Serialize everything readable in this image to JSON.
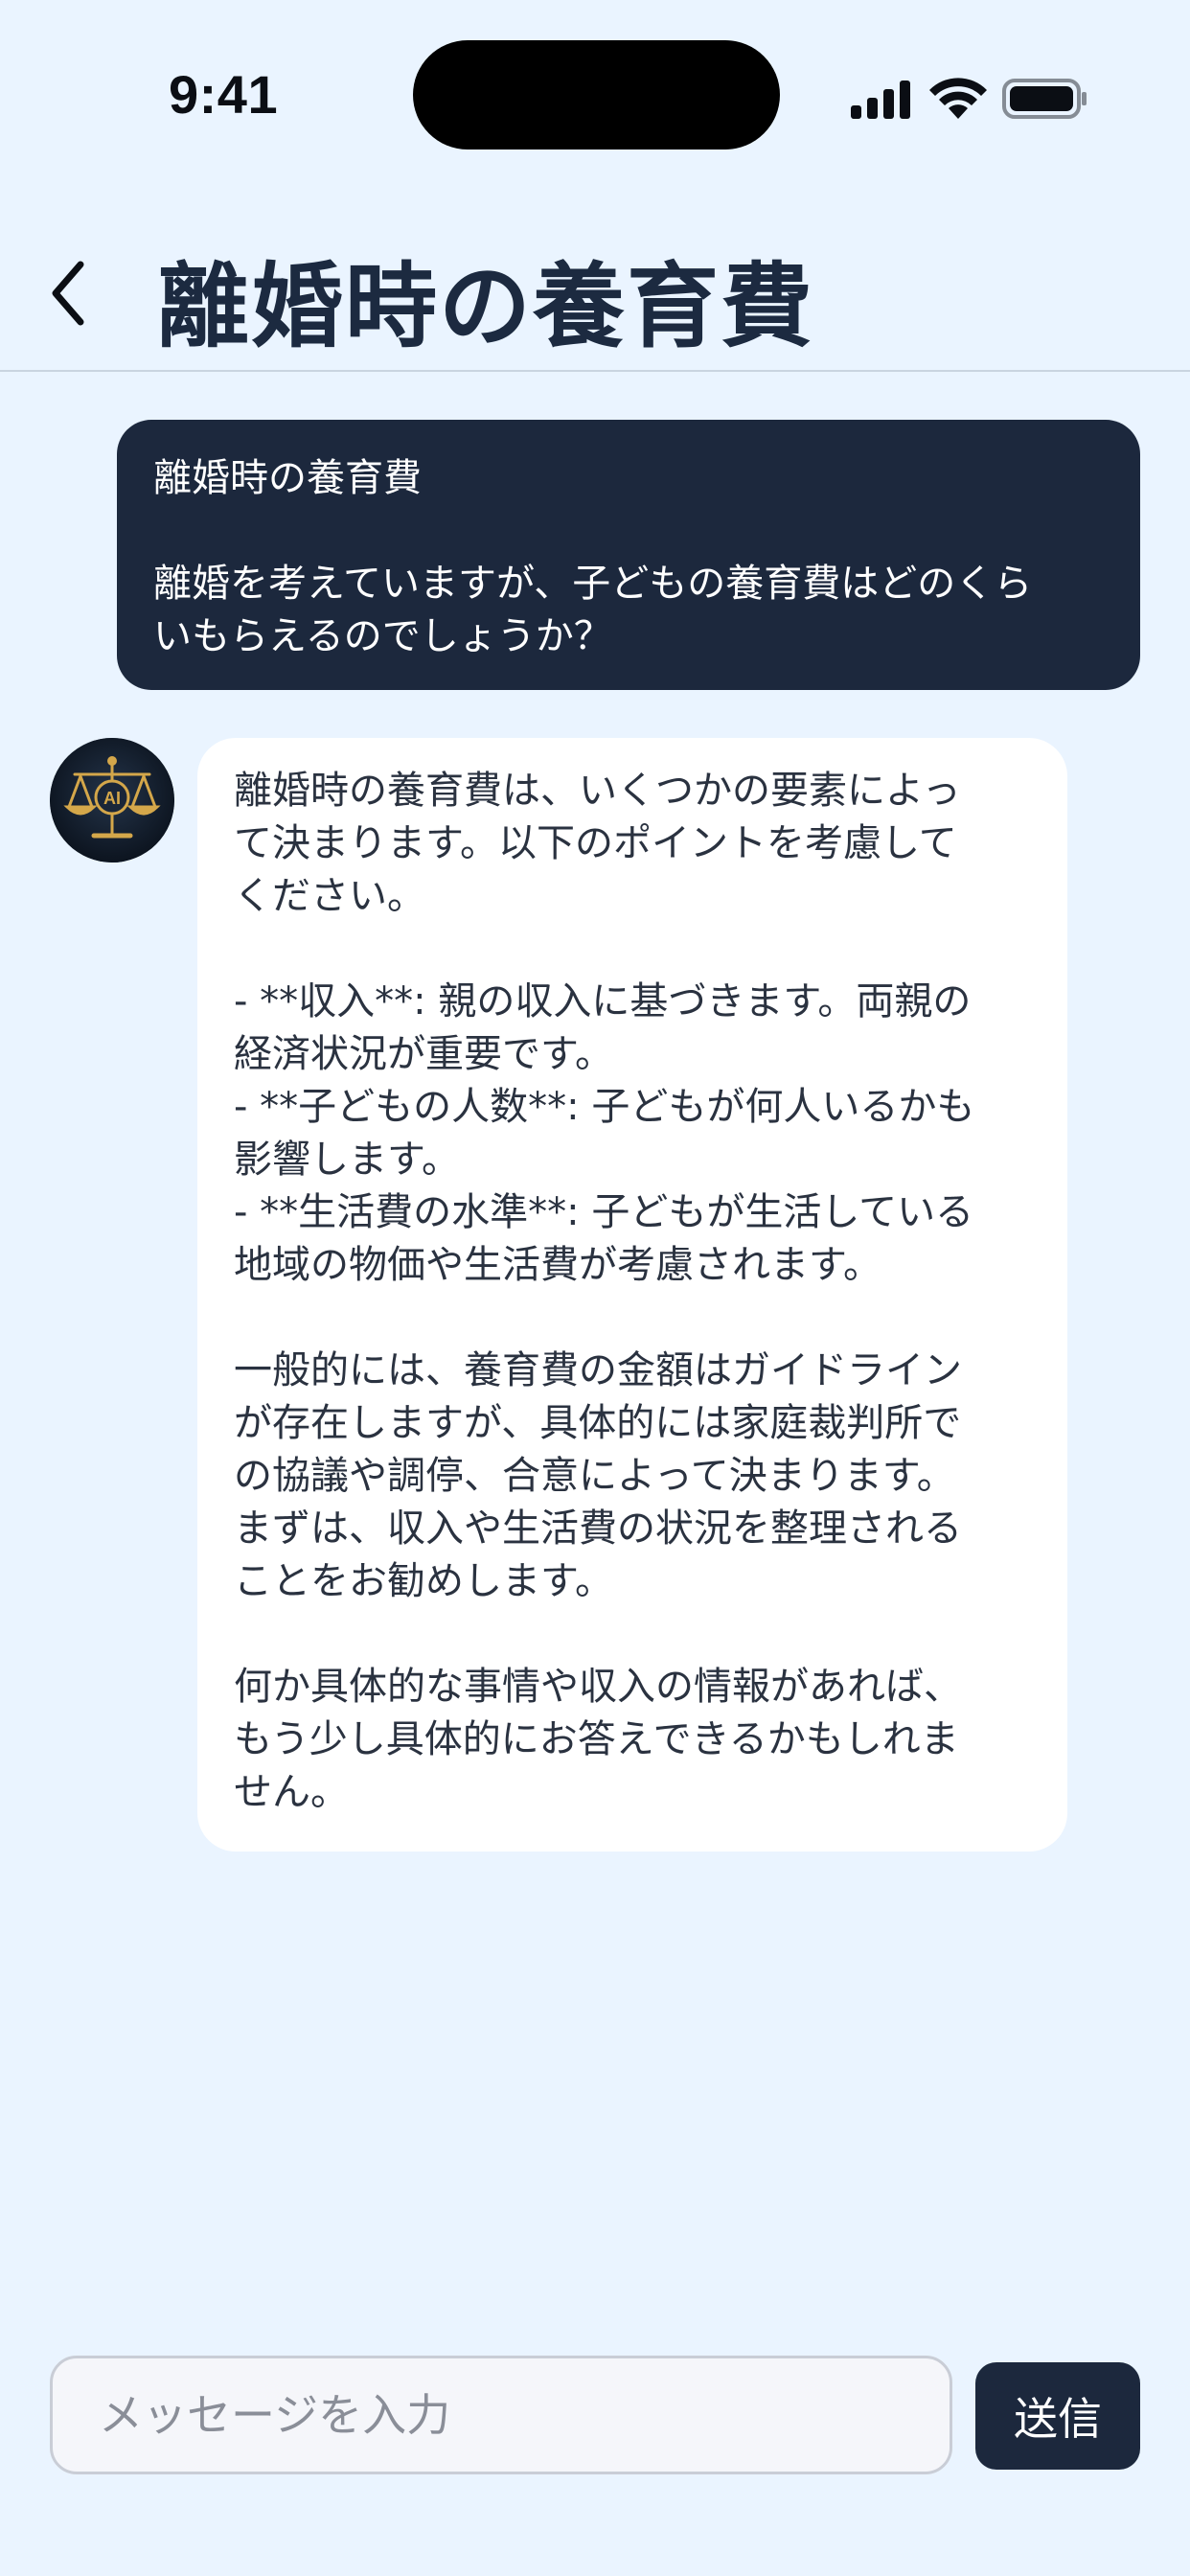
{
  "status_bar": {
    "time": "9:41",
    "icons": [
      "signal-icon",
      "wifi-icon",
      "battery-icon"
    ]
  },
  "header": {
    "back_icon": "chevron-left-icon",
    "title": "離婚時の養育費"
  },
  "messages": {
    "user": {
      "line1": "離婚時の養育費",
      "line2": "離婚を考えていますが、子どもの養育費はどのくら",
      "line3": "いもらえるのでしょうか？"
    },
    "ai": {
      "avatar_icon": "justice-scale-icon",
      "avatar_text": "AI",
      "p1": "離婚時の養育費は、いくつかの要素によっ\nて決まります。以下のポイントを考慮して\nください。",
      "p2": "- **収入**: 親の収入に基づきます。両親の\n経済状況が重要です。\n- **子どもの人数**: 子どもが何人いるかも\n影響します。\n- **生活費の水準**: 子どもが生活している\n地域の物価や生活費が考慮されます。",
      "p3": "一般的には、養育費の金額はガイドライン\nが存在しますが、具体的には家庭裁判所で\nの協議や調停、合意によって決まります。\nまずは、収入や生活費の状況を整理される\nことをお勧めします。",
      "p4": "何か具体的な事情や収入の情報があれば、\nもう少し具体的にお答えできるかもしれま\nせん。"
    }
  },
  "composer": {
    "placeholder": "メッセージを入力",
    "send_label": "送信"
  },
  "colors": {
    "background": "#EAF4FF",
    "user_bubble": "#1C283D",
    "ai_bubble": "#FFFFFF",
    "avatar_gold": "#D4A74A"
  }
}
